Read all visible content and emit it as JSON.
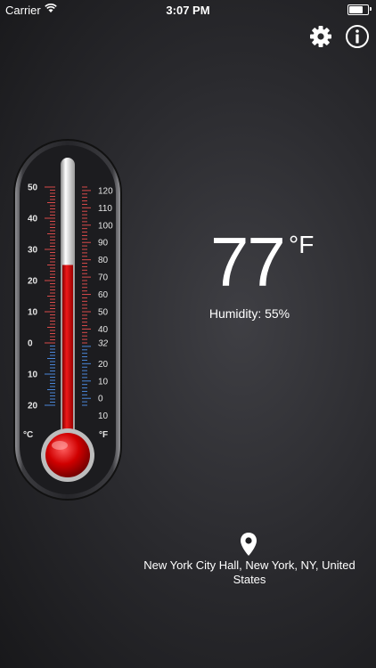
{
  "status_bar": {
    "carrier": "Carrier",
    "time": "3:07 PM",
    "battery_level": 0.75
  },
  "toolbar": {
    "settings_icon": "gear-icon",
    "info_icon": "info-icon"
  },
  "reading": {
    "temperature": "77",
    "unit": "°F",
    "humidity": "Humidity: 55%"
  },
  "thermometer": {
    "celsius_unit": "°C",
    "fahrenheit_unit": "°F",
    "celsius_labels": [
      "50",
      "40",
      "30",
      "20",
      "10",
      "0",
      "10",
      "20"
    ],
    "fahrenheit_labels": [
      "120",
      "110",
      "100",
      "90",
      "80",
      "70",
      "60",
      "50",
      "40",
      "32",
      "20",
      "10",
      "0",
      "10"
    ],
    "mercury_celsius": 25,
    "celsius_range": [
      -25,
      55
    ],
    "colors": {
      "mercury": "#d90000",
      "warm_scale": "#d94a4a",
      "cold_scale": "#4a86d9"
    }
  },
  "location": {
    "icon": "location-pin-icon",
    "text": "New York City Hall, New York, NY, United States"
  }
}
